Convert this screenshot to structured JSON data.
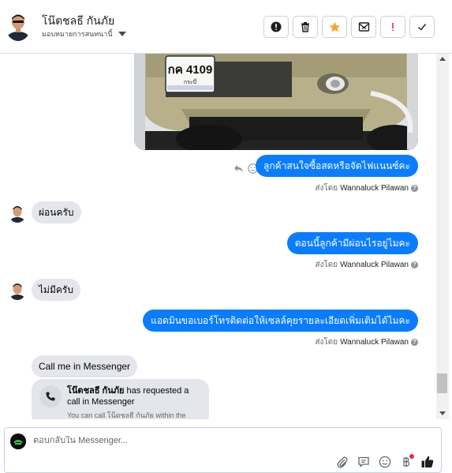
{
  "header": {
    "contact_name": "โน๊ตชลธี กันภัย",
    "assign_label": "มอบหมายการสนทนานี้"
  },
  "toolbar": {
    "buttons": [
      {
        "icon": "alert-circle-icon"
      },
      {
        "icon": "trash-icon"
      },
      {
        "icon": "star-icon",
        "color": "#f5a623"
      },
      {
        "icon": "mail-x-icon"
      },
      {
        "icon": "exclamation-icon",
        "color": "#e0245e"
      },
      {
        "icon": "check-icon"
      }
    ]
  },
  "messages": [
    {
      "direction": "out",
      "text": "ลูกค้าสนใจซื้อสดหรือจัดไฟแนนซ์คะ",
      "sent_by_prefix": "ส่งโดย",
      "sent_by_name": "Wannaluck Pilawan"
    },
    {
      "direction": "in",
      "text": "ผ่อนครับ"
    },
    {
      "direction": "out",
      "text": "ตอนนี้ลูกค้ามีผ่อนไรอยู่ไมคะ",
      "sent_by_prefix": "ส่งโดย",
      "sent_by_name": "Wannaluck Pilawan"
    },
    {
      "direction": "in",
      "text": "ไม่มีครับ"
    },
    {
      "direction": "out",
      "text": "แอดมินขอเบอร์โทรติดต่อให้เซลล์คุยรายละเอียดเพิ่มเติมได้ไมคะ",
      "sent_by_prefix": "ส่งโดย",
      "sent_by_name": "Wannaluck Pilawan"
    },
    {
      "direction": "in",
      "text": "Call me in Messenger"
    }
  ],
  "call_card": {
    "name": "โน๊ตชลธี กันภัย",
    "text": " has requested a call in Messenger",
    "sub": "You can call โน๊ตชลธี กันภัย within the"
  },
  "photo": {
    "plate_text": "กค 4109",
    "plate_province": "กระบี่"
  },
  "composer": {
    "placeholder": "ตอบกลับใน Messenger..."
  },
  "colors": {
    "brand_blue": "#0a7cff",
    "incoming_bubble": "#e4e6eb"
  }
}
